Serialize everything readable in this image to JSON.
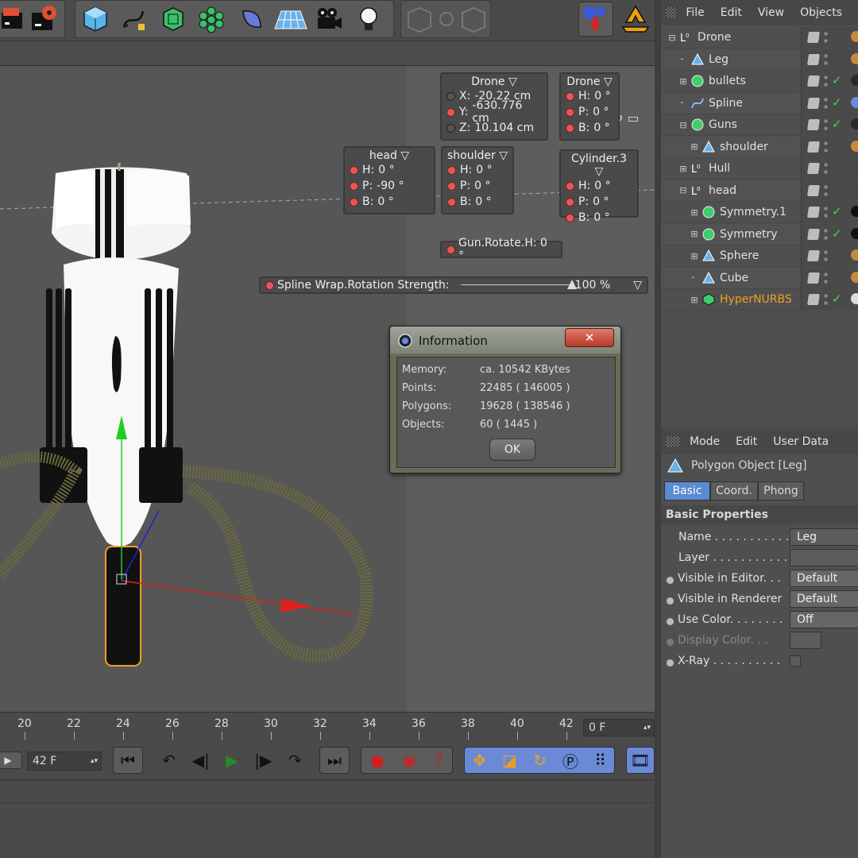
{
  "toolbar": {
    "icons": [
      "clapper-render-icon",
      "clapper-settings-icon",
      "cube-icon",
      "spline-pen-icon",
      "subdivision-icon",
      "cloner-icon",
      "deformer-icon",
      "floor-grid-icon",
      "camera-icon",
      "light-icon",
      "layout-a-icon",
      "layout-b-icon",
      "layout-c-icon",
      "interactive-render-icon",
      "recycle-icon"
    ]
  },
  "viewport": {
    "hud": [
      {
        "title": "Drone",
        "rows": [
          {
            "k": "X:",
            "v": "-20.22 cm"
          },
          {
            "k": "Y:",
            "v": "-630.776 cm"
          },
          {
            "k": "Z:",
            "v": "10.104 cm"
          }
        ]
      },
      {
        "title": "Drone",
        "rows": [
          {
            "k": "H:",
            "v": "0 °"
          },
          {
            "k": "P:",
            "v": "0 °"
          },
          {
            "k": "B:",
            "v": "0 °"
          }
        ]
      },
      {
        "title": "head",
        "rows": [
          {
            "k": "H:",
            "v": "0 °"
          },
          {
            "k": "P:",
            "v": "-90 °"
          },
          {
            "k": "B:",
            "v": "0 °"
          }
        ]
      },
      {
        "title": "shoulder",
        "rows": [
          {
            "k": "H:",
            "v": "0 °"
          },
          {
            "k": "P:",
            "v": "0 °"
          },
          {
            "k": "B:",
            "v": "0 °"
          }
        ]
      },
      {
        "title": "Cylinder.3",
        "rows": [
          {
            "k": "H:",
            "v": "0 °"
          },
          {
            "k": "P:",
            "v": "0 °"
          },
          {
            "k": "B:",
            "v": "0 °"
          }
        ]
      }
    ],
    "gun_rotate": "Gun.Rotate.H:  0 °",
    "spline_wrap_label": "Spline Wrap.Rotation Strength:",
    "spline_wrap_value": "100 %",
    "spline_wrap_fraction": 1.0
  },
  "dialog": {
    "title": "Information",
    "close": "✕",
    "rows": [
      {
        "k": "Memory:",
        "v": "ca. 10542 KBytes"
      },
      {
        "k": "Points:",
        "v": "22485 ( 146005 )"
      },
      {
        "k": "Polygons:",
        "v": "19628 ( 138546 )"
      },
      {
        "k": "Objects:",
        "v": "60 ( 1445 )"
      }
    ],
    "ok": "OK"
  },
  "timeline": {
    "ticks": [
      "20",
      "22",
      "24",
      "26",
      "28",
      "30",
      "32",
      "34",
      "36",
      "38",
      "40",
      "42"
    ],
    "end_field": "0 F",
    "current_field": "42 F"
  },
  "object_manager": {
    "menu": [
      "File",
      "Edit",
      "View",
      "Objects"
    ],
    "items": [
      {
        "name": "Drone",
        "icon": "null",
        "depth": 0,
        "exp": "−",
        "check": false,
        "color": "#e0e0e0"
      },
      {
        "name": "Leg",
        "icon": "poly",
        "depth": 1,
        "exp": "",
        "check": false,
        "color": "#e0e0e0"
      },
      {
        "name": "bullets",
        "icon": "sphere",
        "depth": 1,
        "exp": "+",
        "check": true,
        "color": "#e0e0e0"
      },
      {
        "name": "Spline",
        "icon": "spline",
        "depth": 1,
        "exp": "",
        "check": true,
        "color": "#e0e0e0"
      },
      {
        "name": "Guns",
        "icon": "sphere",
        "depth": 1,
        "exp": "−",
        "check": true,
        "color": "#e0e0e0"
      },
      {
        "name": "shoulder",
        "icon": "poly",
        "depth": 2,
        "exp": "+",
        "check": false,
        "color": "#e0e0e0"
      },
      {
        "name": "Hull",
        "icon": "null",
        "depth": 1,
        "exp": "+",
        "check": false,
        "color": "#e0e0e0"
      },
      {
        "name": "head",
        "icon": "null",
        "depth": 1,
        "exp": "−",
        "check": false,
        "color": "#e0e0e0"
      },
      {
        "name": "Symmetry.1",
        "icon": "sphere",
        "depth": 2,
        "exp": "+",
        "check": true,
        "color": "#e0e0e0"
      },
      {
        "name": "Symmetry",
        "icon": "sphere",
        "depth": 2,
        "exp": "+",
        "check": true,
        "color": "#e0e0e0"
      },
      {
        "name": "Sphere",
        "icon": "poly",
        "depth": 2,
        "exp": "+",
        "check": false,
        "color": "#e0e0e0"
      },
      {
        "name": "Cube",
        "icon": "poly",
        "depth": 2,
        "exp": "",
        "check": false,
        "color": "#e0e0e0"
      },
      {
        "name": "HyperNURBS",
        "icon": "nurbs",
        "depth": 2,
        "exp": "+",
        "check": true,
        "color": "#f0a020"
      }
    ]
  },
  "attributes": {
    "menu": [
      "Mode",
      "Edit",
      "User Data"
    ],
    "object_title": "Polygon Object [Leg]",
    "tabs": [
      "Basic",
      "Coord.",
      "Phong"
    ],
    "section": "Basic Properties",
    "props": [
      {
        "label": "Name . . . . . . . . . . .",
        "value": "Leg",
        "radio": false
      },
      {
        "label": "Layer . . . . . . . . . . .",
        "value": "",
        "radio": false
      },
      {
        "label": "Visible in Editor. . .",
        "value": "Default",
        "radio": true
      },
      {
        "label": "Visible in Renderer",
        "value": "Default",
        "radio": true
      },
      {
        "label": "Use Color. . . . . . . .",
        "value": "Off",
        "radio": true
      },
      {
        "label": "Display Color. . .",
        "value": "",
        "radio": true
      },
      {
        "label": "X-Ray . . . . . . . . . .",
        "value": "",
        "radio": true
      }
    ]
  }
}
